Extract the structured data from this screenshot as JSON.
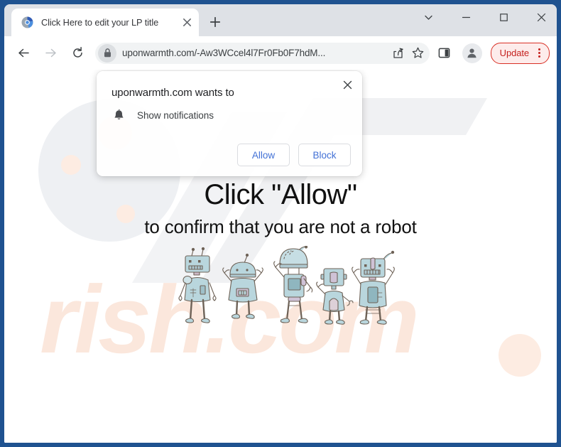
{
  "window": {
    "controls": [
      {
        "name": "chevron-down",
        "label": "⌄"
      },
      {
        "name": "minimize",
        "label": "—"
      },
      {
        "name": "maximize",
        "label": "□"
      },
      {
        "name": "close",
        "label": "✕"
      }
    ]
  },
  "tabstrip": {
    "active_tab": {
      "title": "Click Here to edit your LP title",
      "favicon": "blue-circular-favicon",
      "close_icon": "close-icon"
    },
    "new_tab_icon": "plus-icon"
  },
  "toolbar": {
    "back_icon": "back-arrow-icon",
    "forward_icon": "forward-arrow-icon",
    "reload_icon": "reload-icon",
    "lock_icon": "lock-icon",
    "url": "uponwarmth.com/-Aw3WCcel4l7Fr0Fb0F7hdM...",
    "share_icon": "share-icon",
    "bookmark_icon": "star-icon",
    "side_panel_icon": "side-panel-icon",
    "avatar_icon": "profile-avatar-icon",
    "update_label": "Update",
    "update_menu_icon": "three-dots-vertical-icon",
    "accent_red": "#d93025",
    "accent_red_text": "#c5221f"
  },
  "permission_dialog": {
    "title": "uponwarmth.com wants to",
    "permission_icon": "bell-icon",
    "permission_label": "Show notifications",
    "close_icon": "close-icon",
    "allow_label": "Allow",
    "block_label": "Block",
    "button_text_color": "#4271d6"
  },
  "page": {
    "headline_main": "Click \"Allow\"",
    "headline_sub": "to confirm that you are not a robot",
    "artwork": "five-cartoon-robots-illustration",
    "watermark_text": "rish.com",
    "watermark_text_color": "#fbe7dc",
    "watermark_shape_color": "#f0f1f3",
    "robot_body_color": "#b9d6dd",
    "robot_outline_color": "#6e6257"
  }
}
